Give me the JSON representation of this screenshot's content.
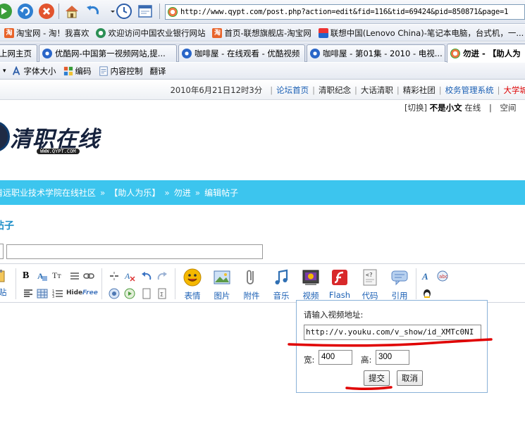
{
  "browser": {
    "url": "http://www.qypt.com/post.php?action=edit&fid=116&tid=69424&pid=850871&page=1",
    "favorites": [
      {
        "label": "淘宝网 - 淘！我喜欢",
        "icon": "taobao-icon"
      },
      {
        "label": "欢迎访问中国农业银行网站",
        "icon": "abc-bank-icon"
      },
      {
        "label": "首页-联想旗舰店-淘宝网",
        "icon": "taobao-icon"
      },
      {
        "label": "联想中国(Lenovo China)-笔记本电脑，台式机，一...",
        "icon": "lenovo-icon"
      }
    ],
    "tabs": [
      {
        "label": "上网主页"
      },
      {
        "label": "优酷网-中国第一视频网站,提..."
      },
      {
        "label": "咖啡屋 - 在线观看 - 优酷视频"
      },
      {
        "label": "咖啡屋 - 第01集 - 2010 - 电视..."
      },
      {
        "label": "勿进 - 【助人为"
      }
    ],
    "commands": [
      {
        "label": "字体大小",
        "icon": "font-size-icon"
      },
      {
        "label": "编码",
        "icon": "encoding-icon"
      },
      {
        "label": "内容控制",
        "icon": "content-control-icon"
      },
      {
        "label": "翻译",
        "icon": ""
      }
    ]
  },
  "site": {
    "date": "2010年6月21日12时3分",
    "nav": [
      "论坛首页",
      "清职纪念",
      "大话清职",
      "精彩社团",
      "校务管理系统",
      "大学城"
    ],
    "user": {
      "switch": "[切换]",
      "visibility": "不是小文",
      "status": "在线",
      "sep": "|",
      "space": "空间"
    },
    "logo": {
      "text": "清职在线",
      "sub": "WWW.QYPT.COM"
    },
    "breadcrumb": [
      "清远职业技术学院在线社区",
      "【助人为乐】",
      "勿进",
      "编辑帖子"
    ],
    "breadcrumb_sep": "»",
    "page_title": "帖子"
  },
  "editor": {
    "big_buttons": [
      {
        "label": "表情",
        "icon": "smiley-icon"
      },
      {
        "label": "图片",
        "icon": "image-icon"
      },
      {
        "label": "附件",
        "icon": "paperclip-icon"
      },
      {
        "label": "音乐",
        "icon": "music-icon"
      },
      {
        "label": "视频",
        "icon": "video-icon"
      },
      {
        "label": "Flash",
        "icon": "flash-icon"
      },
      {
        "label": "代码",
        "icon": "code-icon"
      },
      {
        "label": "引用",
        "icon": "quote-icon"
      }
    ],
    "left_stub": "贴",
    "hide_label": "Hide",
    "free_label": "Free"
  },
  "video_dialog": {
    "prompt": "请输入视频地址:",
    "url_value": "http://v.youku.com/v_show/id_XMTc0NI",
    "width_label": "宽:",
    "width_value": "400",
    "height_label": "高:",
    "height_value": "300",
    "submit": "提交",
    "cancel": "取消"
  },
  "colors": {
    "accent_bar": "#3cc5ee",
    "annotation": "#e00000",
    "link": "#1a5fb4"
  }
}
